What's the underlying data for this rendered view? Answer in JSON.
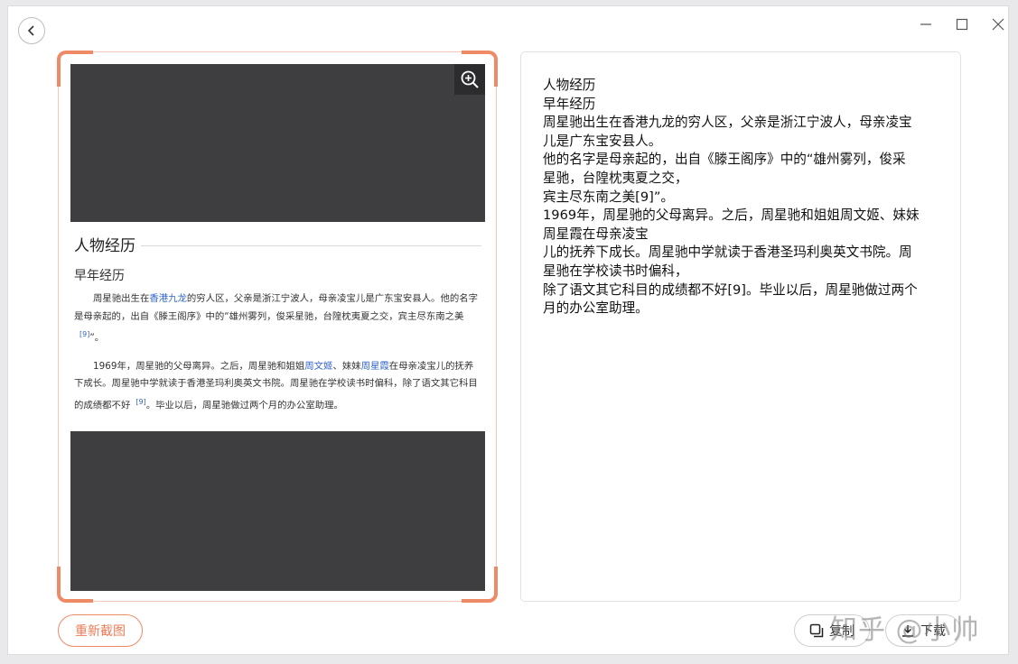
{
  "preview": {
    "heading": "人物经历",
    "subheading": "早年经历",
    "p1_a": "周星驰出生在",
    "p1_link": "香港九龙",
    "p1_b": "的穷人区，父亲是浙江宁波人，母亲凌宝儿是广东宝安县人。他的名字是母亲起的，出自《滕王阁序》中的“雄州雾列，俊采星驰，台隍枕夷夏之交，宾主尽东南之美",
    "p1_ref": "[9]",
    "p1_end": "”。",
    "p2_a": "1969年，周星驰的父母离异。之后，周星驰和姐姐",
    "p2_link1": "周文姬",
    "p2_b": "、妹妹",
    "p2_link2": "周星霞",
    "p2_c": "在母亲凌宝儿的抚养下成长。周星驰中学就读于香港圣玛利奥英文书院。周星驰在学校读书时偏科，除了语文其它科目的成绩都不好",
    "p2_ref": "[9]",
    "p2_end": "。毕业以后，周星驰做过两个月的办公室助理。"
  },
  "ocr_text": [
    "人物经历",
    "早年经历",
    "周星驰出生在香港九龙的穷人区，父亲是浙江宁波人，母亲凌宝",
    "儿是广东宝安县人。",
    "他的名字是母亲起的，出自《滕王阁序》中的“雄州雾列，俊采",
    "星驰，台隍枕夷夏之交，",
    "宾主尽东南之美[9]”。",
    "1969年，周星驰的父母离异。之后，周星驰和姐姐周文姬、妹妹",
    "周星霞在母亲凌宝",
    "儿的抚养下成长。周星驰中学就读于香港圣玛利奥英文书院。周",
    "星驰在学校读书时偏科，",
    "除了语文其它科目的成绩都不好[9]。毕业以后，周星驰做过两个",
    "月的办公室助理。"
  ],
  "buttons": {
    "recapture": "重新截图",
    "copy": "复制",
    "download": "下载"
  },
  "watermark": "知乎 @小帅",
  "icons": {
    "back": "back-arrow-icon",
    "minimize": "minimize-icon",
    "maximize": "maximize-icon",
    "close": "close-icon",
    "zoom": "zoom-in-icon",
    "copy": "copy-icon",
    "download": "download-icon"
  },
  "colors": {
    "accent": "#ef8a66",
    "preview_bg": "#3e3d40",
    "link": "#3366cc"
  }
}
